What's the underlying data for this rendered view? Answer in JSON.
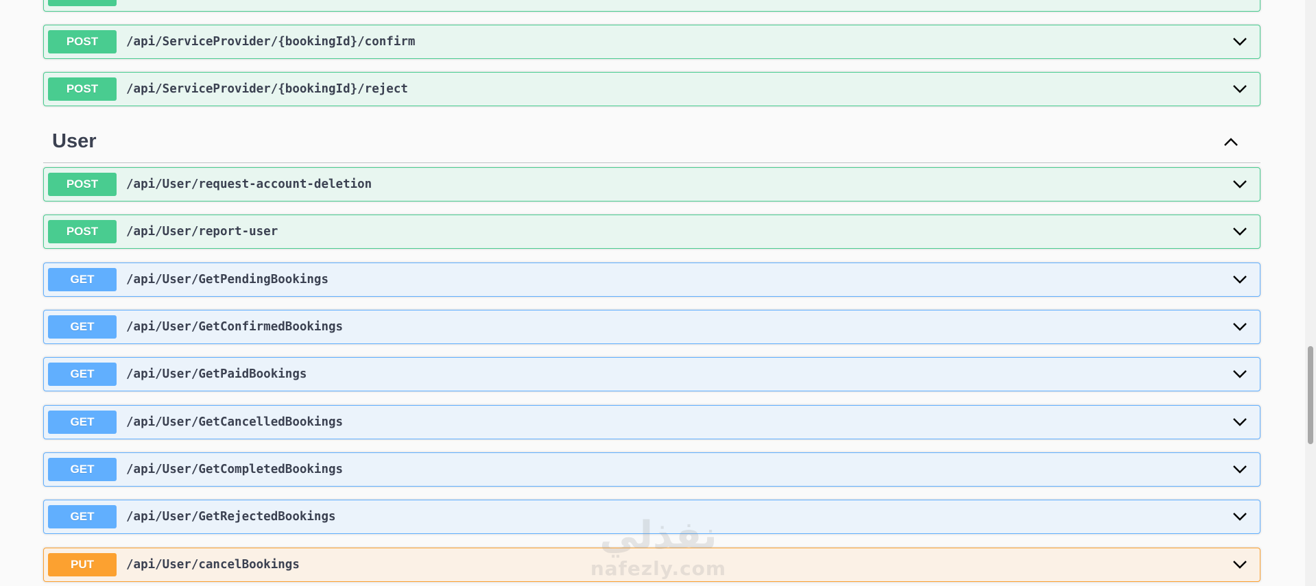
{
  "top_operations": [
    {
      "method": "POST",
      "path": "/api/ServiceProvider/{bookingId}/confirm"
    },
    {
      "method": "POST",
      "path": "/api/ServiceProvider/{bookingId}/reject"
    }
  ],
  "user_section": {
    "title": "User",
    "operations": [
      {
        "method": "POST",
        "path": "/api/User/request-account-deletion"
      },
      {
        "method": "POST",
        "path": "/api/User/report-user"
      },
      {
        "method": "GET",
        "path": "/api/User/GetPendingBookings"
      },
      {
        "method": "GET",
        "path": "/api/User/GetConfirmedBookings"
      },
      {
        "method": "GET",
        "path": "/api/User/GetPaidBookings"
      },
      {
        "method": "GET",
        "path": "/api/User/GetCancelledBookings"
      },
      {
        "method": "GET",
        "path": "/api/User/GetCompletedBookings"
      },
      {
        "method": "GET",
        "path": "/api/User/GetRejectedBookings"
      },
      {
        "method": "PUT",
        "path": "/api/User/cancelBookings"
      }
    ]
  },
  "watermark": {
    "arabic": "نفذلي",
    "latin": "nafezly.com"
  },
  "colors": {
    "post": "#49cc90",
    "get": "#61affe",
    "put": "#fca130",
    "text": "#3b4151"
  },
  "icons": {
    "expand": "chevron-down-icon",
    "collapse": "chevron-up-icon"
  }
}
